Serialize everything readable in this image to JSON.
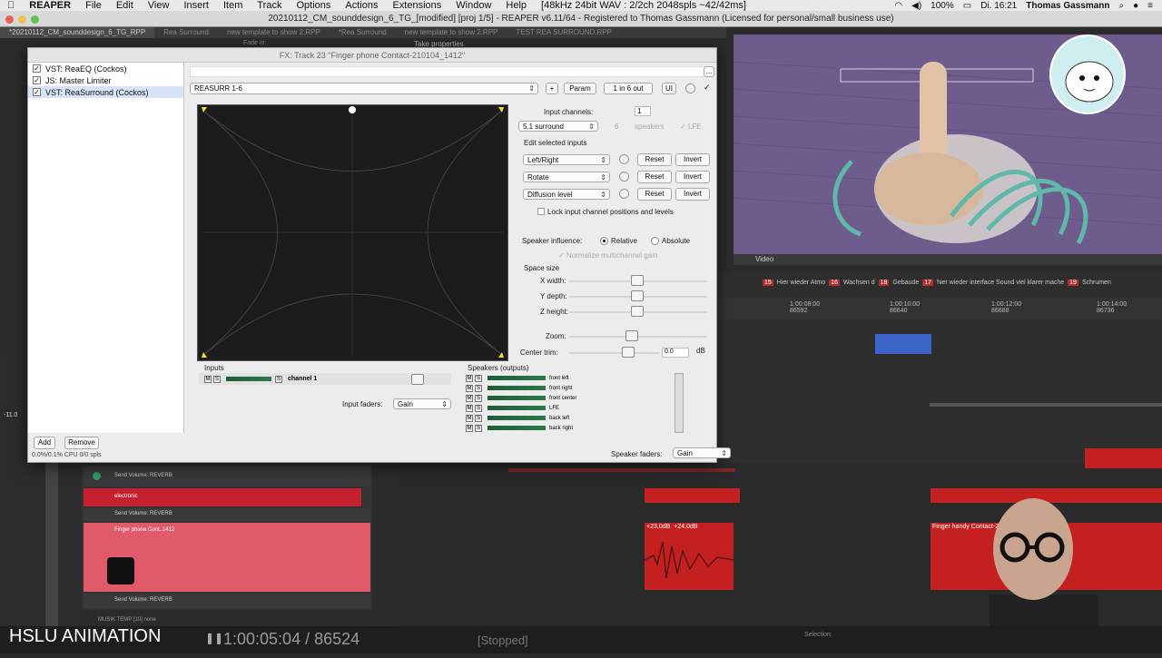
{
  "menubar": {
    "app": "REAPER",
    "items": [
      "File",
      "Edit",
      "View",
      "Insert",
      "Item",
      "Track",
      "Options",
      "Actions",
      "Extensions",
      "Window",
      "Help"
    ],
    "status": "[48kHz 24bit WAV : 2/2ch 2048spls ~42/42ms]",
    "battery": "100%",
    "clock": "Di. 16:21",
    "user": "Thomas Gassmann"
  },
  "window": {
    "title": "20210112_CM_sounddesign_6_TG_[modified] [proj 1/5] - REAPER v6.11/64 - Registered to Thomas Gassmann (Licensed for personal/small business use)"
  },
  "project_tabs": [
    "*20210112_CM_sounddesign_6_TG_RPP",
    "Rea Surround",
    "new template to show 2.RPP",
    "*Rea Surround",
    "new template to show 2.RPP",
    "TEST REA SURROUND.RPP"
  ],
  "fx": {
    "title": "FX: Track 23 \"Finger phone Contact-210104_1412\"",
    "items": [
      {
        "label": "VST: ReaEQ (Cockos)",
        "checked": true
      },
      {
        "label": "JS: Master Limiter",
        "checked": true
      },
      {
        "label": "VST: ReaSurround (Cockos)",
        "checked": true
      }
    ],
    "add_label": "Add",
    "remove_label": "Remove",
    "cpu": "0.0%/0.1% CPU 0/0 spls",
    "preset": "REASURR 1-6",
    "plus": "+",
    "param": "Param",
    "io": "1 in 6 out",
    "ui": "UI",
    "check": "✓",
    "more": "..."
  },
  "surround": {
    "input_channels_label": "Input channels:",
    "input_channels_value": "1",
    "layout": "5.1 surround",
    "speakers_value": "6",
    "speakers_label": "speakers",
    "lfe_label": "LFE",
    "edit_selected": "Edit selected inputs",
    "rows": [
      {
        "mode": "Left/Right",
        "reset": "Reset",
        "invert": "Invert"
      },
      {
        "mode": "Rotate",
        "reset": "Reset",
        "invert": "Invert"
      },
      {
        "mode": "Diffusion level",
        "reset": "Reset",
        "invert": "Invert"
      }
    ],
    "lock_label": "Lock input channel positions and levels",
    "speaker_influence": "Speaker influence:",
    "relative": "Relative",
    "absolute": "Absolute",
    "normalize": "Normalize multichannel gain",
    "space_size": "Space size",
    "x_width": "X width:",
    "y_depth": "Y depth:",
    "z_height": "Z height:",
    "zoom": "Zoom:",
    "center_trim": "Center trim:",
    "center_trim_value": "0.0",
    "db": "dB",
    "inputs_label": "Inputs",
    "input_channel_name": "channel 1",
    "input_faders_label": "Input faders:",
    "input_faders_value": "Gain",
    "speakers_outputs_label": "Speakers (outputs)",
    "speakers": [
      "front left",
      "front right",
      "front center",
      "LFE",
      "back left",
      "back right"
    ],
    "speaker_faders_label": "Speaker faders:",
    "speaker_faders_value": "Gain",
    "m": "M",
    "s": "S"
  },
  "video": {
    "label": "Video"
  },
  "markers": [
    {
      "num": "15",
      "text": "Hier wieder Atmo"
    },
    {
      "num": "16",
      "text": "Wachsen d"
    },
    {
      "num": "18",
      "text": "Gebaude"
    },
    {
      "num": "17",
      "text": "hier wieder interface Sound viel klarer mache"
    },
    {
      "num": "19",
      "text": "Schrumen"
    }
  ],
  "ruler": [
    {
      "time": "1:00:08:00",
      "frames": "86592"
    },
    {
      "time": "1:00:10:00",
      "frames": "86640"
    },
    {
      "time": "1:00:12:00",
      "frames": "86688"
    },
    {
      "time": "1:00:14:00",
      "frames": "86736"
    }
  ],
  "tracks": [
    {
      "name": "Send Volume: REVERB"
    },
    {
      "name": "electronic"
    },
    {
      "name": "Send Volume: REVERB"
    },
    {
      "name": "Finger phone Cont..1412"
    },
    {
      "name": "Send Volume: REVERB"
    }
  ],
  "items": {
    "gain1": "+23.0dB",
    "gain2": "+24.0dB",
    "finger_item": "Finger handy Contact-2101"
  },
  "bottom": {
    "brand": "HSLU ANIMATION",
    "timecode": "1:00:05:04 / 86524",
    "state": "[Stopped]",
    "selection": "Selection:"
  },
  "mixer_track": "MUSIK TEMP [10] none",
  "fade_label": "Fade in:",
  "take_props": "Take properties"
}
